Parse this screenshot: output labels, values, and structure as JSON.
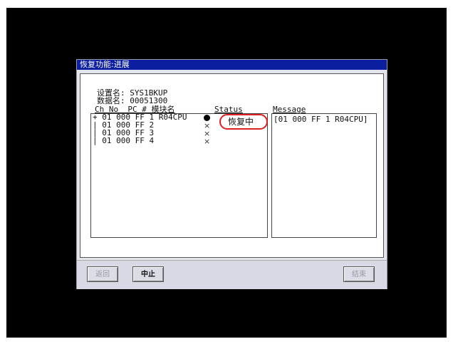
{
  "dialog": {
    "title": "恢复功能:进展",
    "settings_label": "设置名: SYS1BKUP",
    "data_label": "数据名: 00051300"
  },
  "list": {
    "header": "Ch No  PC # 模块名",
    "status_header": "Status",
    "rows": [
      {
        "text": "+ 01 000 FF 1 R04CPU",
        "mark": "●",
        "status": "恢复中"
      },
      {
        "text": "| 01 000 FF 2",
        "mark": "×",
        "status": ""
      },
      {
        "text": "| 01 000 FF 3",
        "mark": "×",
        "status": ""
      },
      {
        "text": "| 01 000 FF 4",
        "mark": "×",
        "status": ""
      }
    ]
  },
  "message": {
    "header": "Message",
    "text": "[01 000 FF 1 R04CPU]"
  },
  "footer": {
    "back_label": "返回",
    "abort_label": "中止",
    "finish_label": "结束"
  }
}
